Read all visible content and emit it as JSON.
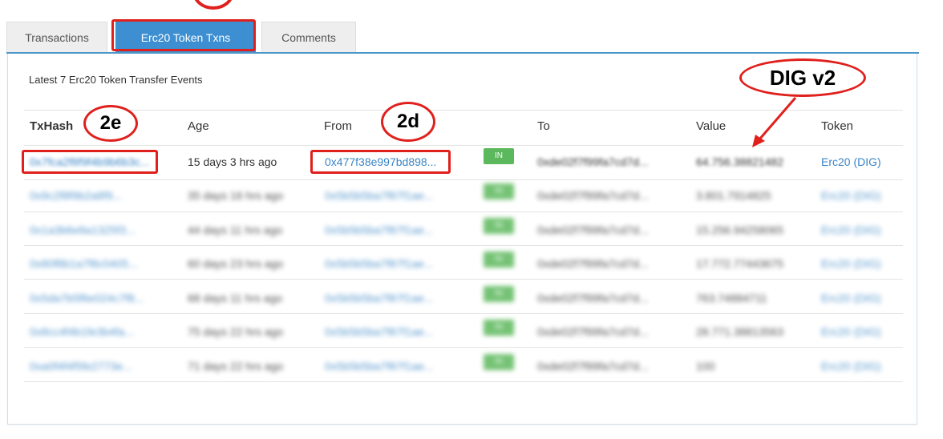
{
  "tabs": [
    {
      "label": "Transactions",
      "active": false
    },
    {
      "label": "Erc20 Token Txns",
      "active": true
    },
    {
      "label": "Comments",
      "active": false
    }
  ],
  "caption": "Latest 7 Erc20 Token Transfer Events",
  "columns": {
    "txhash": "TxHash",
    "age": "Age",
    "from": "From",
    "to": "To",
    "value": "Value",
    "token": "Token"
  },
  "rows": [
    {
      "txhash": "0x7fca2f8f9f4b9b6b3c...",
      "age": "15 days 3 hrs ago",
      "from": "0x477f38e997bd898...",
      "direction": "IN",
      "to": "0xde02f7f99fa7cd7d...",
      "value": "64.756.38821482",
      "token": "Erc20 (DIG)"
    },
    {
      "txhash": "0x9c2f8f9b2a8f9...",
      "age": "35 days 16 hrs ago",
      "from": "0x5b5b5ba7f87f1ae...",
      "direction": "IN",
      "to": "0xde02f7f99fa7cd7d...",
      "value": "3.801.7914825",
      "token": "Erc20 (DIG)"
    },
    {
      "txhash": "0x1a3b6e8a1325f3...",
      "age": "44 days 11 hrs ago",
      "from": "0x5b5b5ba7f87f1ae...",
      "direction": "IN",
      "to": "0xde02f7f99fa7cd7d...",
      "value": "15.256.94258065",
      "token": "Erc20 (DIG)"
    },
    {
      "txhash": "0x80f8b1a7f8c0405...",
      "age": "60 days 23 hrs ago",
      "from": "0x5b5b5ba7f87f1ae...",
      "direction": "IN",
      "to": "0xde02f7f99fa7cd7d...",
      "value": "17.772.77443675",
      "token": "Erc20 (DIG)"
    },
    {
      "txhash": "0x5da7b5f6e024c7f8...",
      "age": "68 days 11 hrs ago",
      "from": "0x5b5b5ba7f87f1ae...",
      "direction": "IN",
      "to": "0xde02f7f99fa7cd7d...",
      "value": "763.74884711",
      "token": "Erc20 (DIG)"
    },
    {
      "txhash": "0x8cc4f4b1fe3b4fa...",
      "age": "75 days 22 hrs ago",
      "from": "0x5b5b5ba7f87f1ae...",
      "direction": "IN",
      "to": "0xde02f7f99fa7cd7d...",
      "value": "28.771.38813563",
      "token": "Erc20 (DIG)"
    },
    {
      "txhash": "0xa0f4f4f5fe2773e...",
      "age": "71 days 22 hrs ago",
      "from": "0x5b5b5ba7f87f1ae...",
      "direction": "IN",
      "to": "0xde02f7f99fa7cd7d...",
      "value": "100",
      "token": "Erc20 (DIG)"
    }
  ],
  "annotations": {
    "txhash_label": "2e",
    "from_label": "2d",
    "value_label": "DIG v2"
  },
  "colors": {
    "accent": "#3d8fd1",
    "link": "#3a85c6",
    "badge": "#5cb85c",
    "annotation": "#e0201d"
  }
}
